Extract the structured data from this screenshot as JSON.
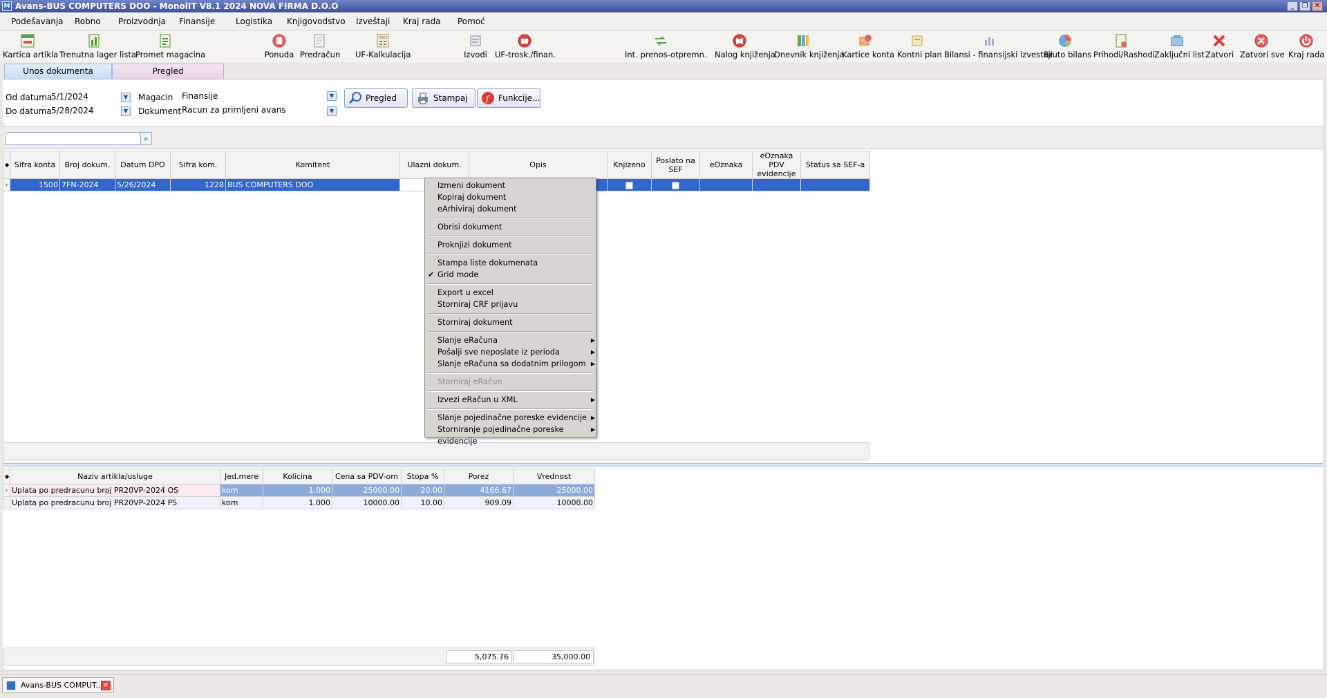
{
  "window": {
    "title": "Avans-BUS COMPUTERS DOO - MonolIT V8.1 2024 NOVA FIRMA D.O.O"
  },
  "menu": [
    "Podešavanja",
    "Robno",
    "Proizvodnja",
    "Finansije",
    "Logistika",
    "Knjigovodstvo",
    "Izveštaji",
    "Kraj rada",
    "Pomoć"
  ],
  "toolbar": [
    {
      "label": "Kartica artikla",
      "icon": "article-card-icon"
    },
    {
      "label": "Trenutna lager lista",
      "icon": "stock-list-icon"
    },
    {
      "label": "Promet magacina",
      "icon": "warehouse-turnover-icon"
    },
    {
      "label": "Ponuda",
      "icon": "offer-icon"
    },
    {
      "label": "Predračun",
      "icon": "proforma-icon"
    },
    {
      "label": "UF-Kalkulacija",
      "icon": "calculation-icon"
    },
    {
      "label": "Izvodi",
      "icon": "statements-icon"
    },
    {
      "label": "UF-trosk./finan.",
      "icon": "expenses-icon"
    },
    {
      "label": "Int. prenos-otpremn.",
      "icon": "transfer-icon"
    },
    {
      "label": "Nalog knjiženja",
      "icon": "posting-order-icon"
    },
    {
      "label": "Dnevnik knjiženja",
      "icon": "posting-journal-icon"
    },
    {
      "label": "Kartice konta",
      "icon": "account-cards-icon"
    },
    {
      "label": "Kontni plan",
      "icon": "chart-of-accounts-icon"
    },
    {
      "label": "Bilansi - finansijski izvestaji",
      "icon": "balance-sheets-icon"
    },
    {
      "label": "Bruto bilans",
      "icon": "gross-balance-icon"
    },
    {
      "label": "Prihodi/Rashodi",
      "icon": "income-expense-icon"
    },
    {
      "label": "Zaključni list",
      "icon": "closing-sheet-icon"
    },
    {
      "label": "Zatvori",
      "icon": "close-icon"
    },
    {
      "label": "Zatvori sve",
      "icon": "close-all-icon"
    },
    {
      "label": "Kraj rada",
      "icon": "power-icon"
    }
  ],
  "tabs": [
    "Unos dokumenta",
    "Pregled"
  ],
  "filter": {
    "od_label": "Od datuma",
    "od_value": "5/1/2024",
    "do_label": "Do datuma",
    "do_value": "5/28/2024",
    "magacin_label": "Magacin",
    "magacin_value": "Finansije",
    "dokument_label": "Dokument",
    "dokument_value": "Racun za primljeni avans",
    "btn_pregled": "Pregled",
    "btn_stampaj": "Stampaj",
    "btn_funkcije": "Funkcije..."
  },
  "search": {
    "placeholder": ""
  },
  "grid1": {
    "headers": [
      "Sifra konta",
      "Broj dokum.",
      "Datum DPO",
      "Sifra kom.",
      "Komitent",
      "Ulazni dokum.",
      "Opis",
      "Knjizeno",
      "Poslato na SEF",
      "eOznaka",
      "eOznaka PDV evidencije",
      "Status sa SEF-a"
    ],
    "rows": [
      {
        "sifra_konta": "1500",
        "broj": "7FN-2024",
        "datum": "5/26/2024",
        "sifra_kom": "1228",
        "komitent": "BUS COMPUTERS DOO",
        "ulazni": "",
        "opis": "",
        "knjizeno": false,
        "poslato": false,
        "eoznaka": "",
        "eoznaka_pdv": "",
        "status": ""
      }
    ]
  },
  "context_menu": {
    "items": [
      {
        "label": "Izmeni dokument"
      },
      {
        "label": "Kopiraj dokument"
      },
      {
        "label": "eArhiviraj dokument"
      },
      {
        "label": "Obrisi dokument"
      },
      {
        "label": "Proknjizi dokument"
      },
      {
        "label": "Stampa liste dokumenata"
      },
      {
        "label": "Grid mode",
        "checked": true
      },
      {
        "label": "Export u excel"
      },
      {
        "label": "Storniraj CRF prijavu"
      },
      {
        "label": "Storniraj dokument"
      },
      {
        "label": "Slanje eRačuna",
        "submenu": true
      },
      {
        "label": "Pošalji sve neposlate iz perioda",
        "submenu": true
      },
      {
        "label": "Slanje eRačuna sa dodatnim prilogom",
        "submenu": true
      },
      {
        "label": "Storniraj eRačun",
        "disabled": true
      },
      {
        "label": "Izvezi eRačun u XML",
        "submenu": true
      },
      {
        "label": "Slanje pojedinačne poreske evidencije",
        "submenu": true
      },
      {
        "label": "Storniranje pojedinačne poreske evidencije",
        "submenu": true
      }
    ]
  },
  "grid2": {
    "headers": [
      "Naziv artikla/usluge",
      "Jed.mere",
      "Kolicina",
      "Cena sa PDV-om",
      "Stopa %",
      "Porez",
      "Vrednost"
    ],
    "rows": [
      [
        "Uplata po predracunu broj PR20VP-2024 OS",
        "kom",
        "1.000",
        "25000.00",
        "20.00",
        "4166.67",
        "25000.00"
      ],
      [
        "Uplata po predracunu broj PR20VP-2024 PS",
        "kom",
        "1.000",
        "10000.00",
        "10.00",
        "909.09",
        "10000.00"
      ]
    ],
    "totals": {
      "porez": "5,075.76",
      "vrednost": "35,000.00"
    }
  },
  "taskbar": {
    "item": "Avans-BUS COMPUT..."
  },
  "colors": {
    "selection": "#3366cc",
    "titlebar": "#3a4f9c",
    "tab_active": "#e8e0ec",
    "tab_inactive": "#d7e6f7"
  }
}
